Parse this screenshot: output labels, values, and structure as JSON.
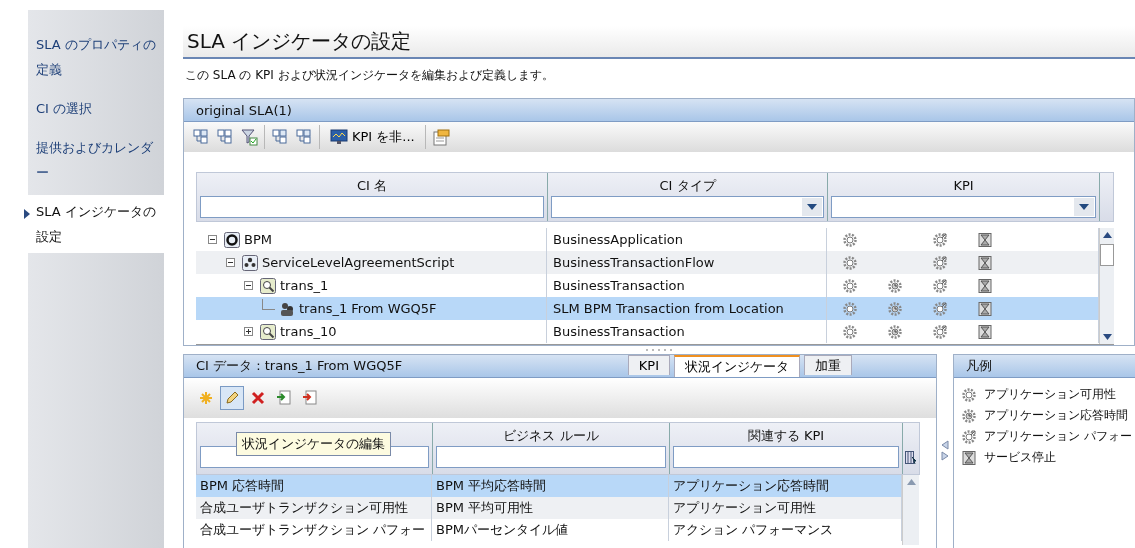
{
  "sidebar": {
    "items": [
      {
        "label": "SLA のプロパティの定義",
        "selected": false
      },
      {
        "label": "CI の選択",
        "selected": false
      },
      {
        "label": "提供およびカレンダー",
        "selected": false
      },
      {
        "label": "SLA インジケータの設定",
        "selected": true
      }
    ]
  },
  "page": {
    "title": "SLA インジケータの設定",
    "description": "この SLA の KPI および状況インジケータを編集および定義します。"
  },
  "tree_panel": {
    "title": "original SLA(1)",
    "toolbar": [
      {
        "kind": "icon"
      },
      {
        "kind": "icon"
      },
      {
        "kind": "icon"
      },
      {
        "kind": "separator"
      },
      {
        "kind": "icon"
      },
      {
        "kind": "icon"
      },
      {
        "kind": "separator"
      },
      {
        "kind": "text",
        "label": "KPI を非..."
      },
      {
        "kind": "separator"
      },
      {
        "kind": "icon"
      }
    ],
    "columns": [
      "CI 名",
      "CI タイプ",
      "KPI"
    ],
    "rows": [
      {
        "name": "BPM",
        "kind": "application",
        "expanded": true,
        "type": "BusinessApplication",
        "selected": false,
        "kpi_shown": [
          true,
          false,
          true,
          true
        ],
        "children": [
          {
            "name": "ServiceLevelAgreementScript",
            "kind": "flow",
            "expanded": true,
            "type": "BusinessTransactionFlow",
            "selected": false,
            "kpi_shown": [
              true,
              false,
              true,
              true
            ],
            "children": [
              {
                "name": "trans_1",
                "kind": "transaction",
                "expanded": true,
                "type": "BusinessTransaction",
                "selected": false,
                "kpi_shown": [
                  true,
                  true,
                  true,
                  true
                ],
                "children": [
                  {
                    "name": "trans_1 From WGQ5F",
                    "kind": "location",
                    "type": "SLM BPM Transaction from Location",
                    "selected": true,
                    "kpi_shown": [
                      true,
                      true,
                      true,
                      true
                    ]
                  }
                ]
              },
              {
                "name": "trans_10",
                "kind": "transaction",
                "expanded": false,
                "type": "BusinessTransaction",
                "selected": false,
                "kpi_shown": [
                  true,
                  true,
                  true,
                  true
                ]
              }
            ]
          }
        ]
      }
    ]
  },
  "ci_data_panel": {
    "title": "CI データ : trans_1 From WGQ5F",
    "tabs": [
      {
        "label": "KPI",
        "selected": false
      },
      {
        "label": "状況インジケータ",
        "selected": true
      },
      {
        "label": "加重",
        "selected": false
      }
    ],
    "toolbar": [
      {
        "pressed": false
      },
      {
        "pressed": true
      },
      {
        "pressed": false
      },
      {
        "pressed": false
      },
      {
        "pressed": false
      }
    ],
    "tooltip": "状況インジケータの編集",
    "columns": [
      "",
      "ビジネス ルール",
      "関連する KPI"
    ],
    "rows": [
      {
        "cells": [
          "BPM 応答時間",
          "BPM 平均応答時間",
          "アプリケーション応答時間"
        ],
        "selected": true
      },
      {
        "cells": [
          "合成ユーザトランザクション可用性",
          "BPM 平均可用性",
          "アプリケーション可用性"
        ],
        "selected": false
      },
      {
        "cells": [
          "合成ユーザトランザクション パフォー",
          "BPMパーセンタイル値",
          "アクション パフォーマンス"
        ],
        "selected": false
      }
    ]
  },
  "legend": {
    "title": "凡例",
    "items": [
      {
        "label": "アプリケーション可用性"
      },
      {
        "label": "アプリケーション応答時間"
      },
      {
        "label": "アプリケーション パフォー"
      },
      {
        "label": "サービス停止"
      }
    ]
  }
}
